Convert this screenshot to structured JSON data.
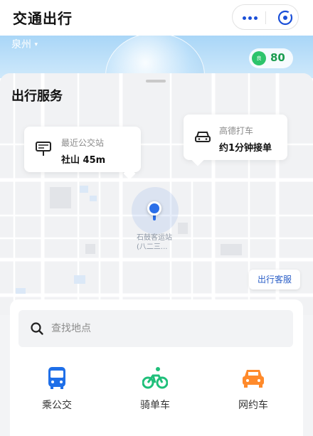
{
  "header": {
    "title": "交通出行",
    "more_icon": "more-dots-icon",
    "close_icon": "close-circle-icon",
    "accent": "#1a4fd8"
  },
  "location": {
    "city": "泉州",
    "caret": "▾",
    "aqi_label": "良",
    "aqi_value": "80",
    "aqi_color": "#2dc46b"
  },
  "panel": {
    "title": "出行服务",
    "bus_card": {
      "icon": "bus-stop-icon",
      "label": "最近公交站",
      "value": "社山 45m"
    },
    "taxi_card": {
      "icon": "taxi-icon",
      "label": "高德打车",
      "value": "约1分钟接单"
    },
    "poi": {
      "line1": "石鼓客运站",
      "line2": "(八二三..."
    },
    "service_button": "出行客服"
  },
  "search": {
    "placeholder": "查找地点",
    "icon": "search-icon"
  },
  "modes": [
    {
      "label": "乘公交",
      "icon": "bus-icon",
      "color": "#1f6fe8"
    },
    {
      "label": "骑单车",
      "icon": "bike-icon",
      "color": "#1fbf7a"
    },
    {
      "label": "网约车",
      "icon": "car-icon",
      "color": "#ff8a2b"
    }
  ]
}
